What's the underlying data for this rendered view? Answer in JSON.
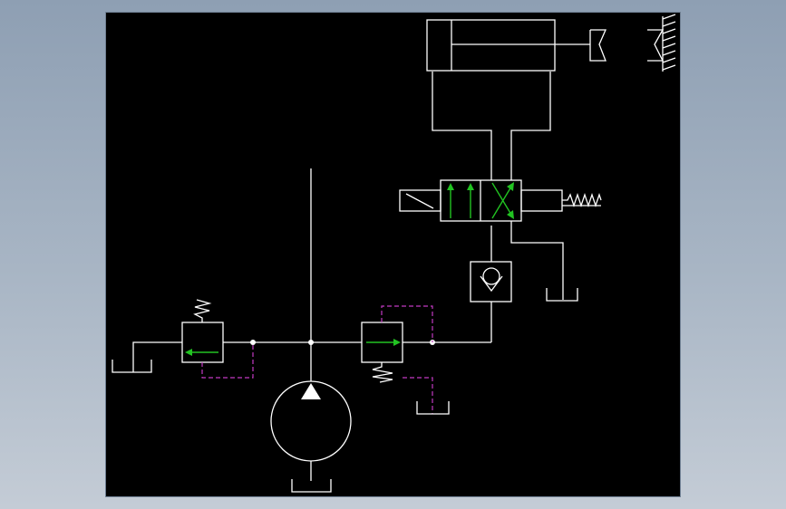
{
  "viewport": {
    "background_gradient": [
      "#8e9fb3",
      "#c4ccd6"
    ],
    "canvas_background": "#000000"
  },
  "colors": {
    "line": "#ffffff",
    "flow_arrow": "#22c322",
    "pilot_line": "#c23ac2"
  },
  "diagram": {
    "type": "hydraulic-schematic",
    "components": [
      "hydraulic-pump",
      "relief-valve",
      "pressure-reducing-valve",
      "check-valve",
      "solenoid-directional-valve",
      "double-acting-cylinder",
      "workpiece-clamp",
      "fixed-wall",
      "tank"
    ]
  }
}
